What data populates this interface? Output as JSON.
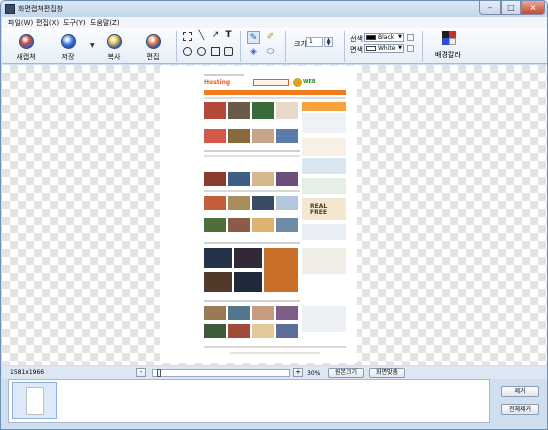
{
  "window": {
    "title": "화면캡쳐편집창"
  },
  "menu": [
    "파일(W)",
    "편집(X)",
    "도구(Y)",
    "도움말(Z)"
  ],
  "toolbar": {
    "new_capture": "새캡쳐",
    "save": "저장",
    "copy": "복사",
    "edit": "편집",
    "size_label": "크기",
    "size_value": "1",
    "line_color_label": "선색",
    "line_color_value": "Black",
    "line_color_hex": "#000000",
    "fill_color_label": "면색",
    "fill_color_value": "White",
    "fill_color_hex": "#ffffff",
    "bg_color": "배경칼라"
  },
  "status": {
    "dimensions": "1581x1966",
    "zoom_minus": "-",
    "zoom_plus": "+",
    "zoom_value": "30%",
    "original_size": "원본크기",
    "fit_screen": "화면맞춤",
    "zoom_level": 0.3
  },
  "side_buttons": {
    "remove": "제거",
    "remove_all": "전체제거"
  },
  "captured_page": {
    "brand_left": "Hosting",
    "brand_right": "WEB",
    "headline": "REAL FREE"
  }
}
